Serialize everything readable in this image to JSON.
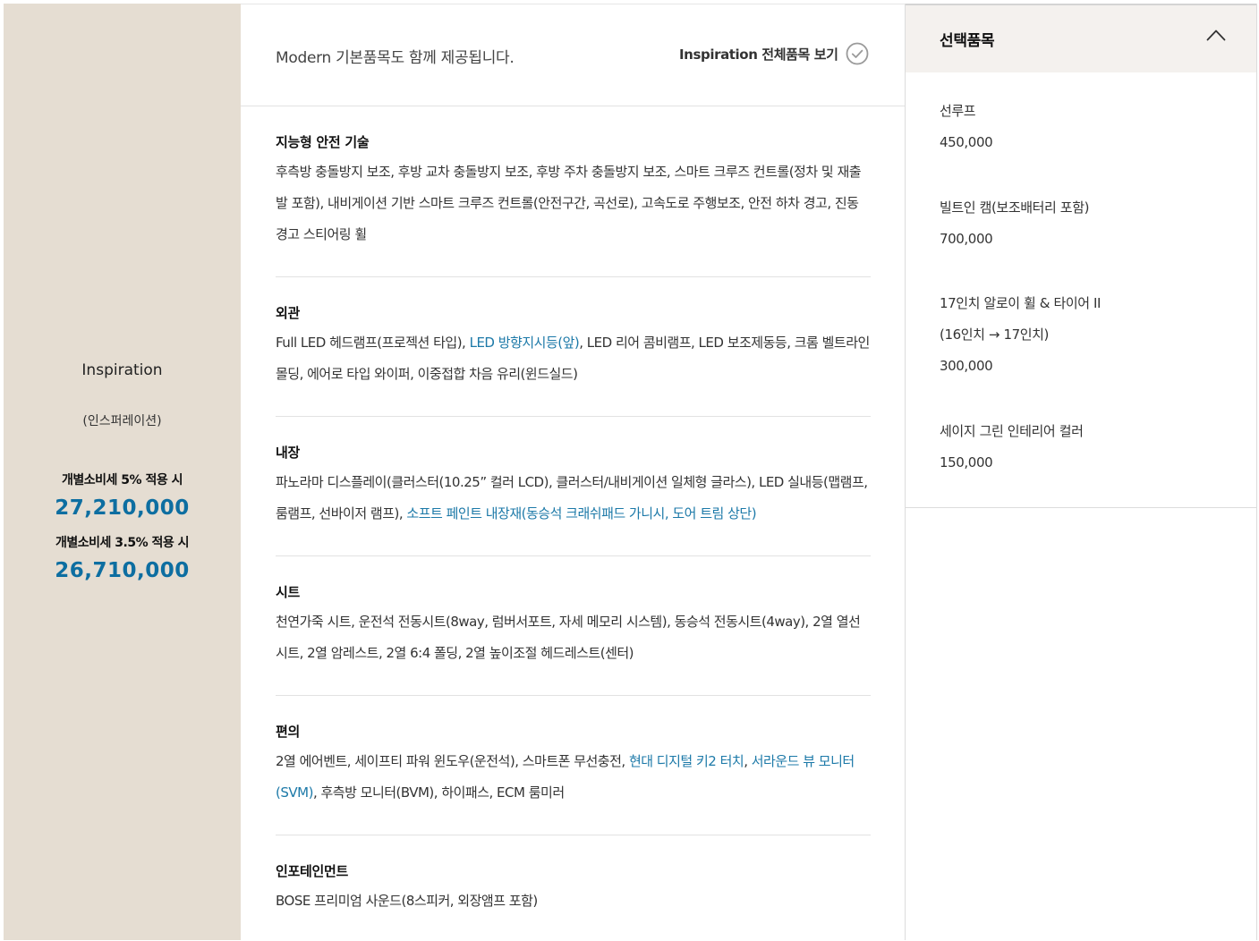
{
  "trim": {
    "name": "Inspiration",
    "sub": "(인스퍼레이션)",
    "tax5_label": "개별소비세 5% 적용 시",
    "tax5_price": "27,210,000",
    "tax35_label": "개별소비세 3.5% 적용 시",
    "tax35_price": "26,710,000"
  },
  "header": {
    "notice": "Modern 기본품목도 함께 제공됩니다.",
    "view_all": "Inspiration 전체품목 보기",
    "check_icon": "check-circle-icon"
  },
  "sections": [
    {
      "title": "지능형 안전 기술",
      "parts": [
        "후측방 충돌방지 보조, 후방 교차 충돌방지 보조, 후방 주차 충돌방지 보조, 스마트 크루즈 컨트롤(정차 및 재출발 포함), 내비게이션 기반 스마트 크루즈 컨트롤(안전구간, 곡선로), 고속도로 주행보조, 안전 하차 경고, 진동 경고 스티어링 휠"
      ]
    },
    {
      "title": "외관",
      "parts": [
        "Full LED 헤드램프(프로젝션 타입), ",
        "LED 방향지시등(앞)",
        ", LED 리어 콤비램프, LED 보조제동등, 크롬 벨트라인 몰딩, 에어로 타입 와이퍼, 이중접합 차음 유리(윈드실드)"
      ]
    },
    {
      "title": "내장",
      "parts": [
        "파노라마 디스플레이(클러스터(10.25” 컬러 LCD), 클러스터/내비게이션 일체형 글라스), LED 실내등(맵램프, 룸램프, 선바이저 램프), ",
        "소프트 페인트 내장재(동승석 크래쉬패드 가니시, 도어 트림 상단)"
      ]
    },
    {
      "title": "시트",
      "parts": [
        "천연가죽 시트, 운전석 전동시트(8way, 럼버서포트, 자세 메모리 시스템), 동승석 전동시트(4way), 2열 열선시트, 2열 암레스트, 2열 6:4 폴딩, 2열 높이조절 헤드레스트(센터)"
      ]
    },
    {
      "title": "편의",
      "parts": [
        "2열 에어벤트, 세이프티 파워 윈도우(운전석), 스마트폰 무선충전, ",
        "현대 디지털 키2 터치",
        ", ",
        "서라운드 뷰 모니터(SVM)",
        ", 후측방 모니터(BVM), 하이패스, ECM 룸미러"
      ]
    },
    {
      "title": "인포테인먼트",
      "parts": [
        "BOSE 프리미엄 사운드(8스피커, 외장앰프 포함)"
      ]
    }
  ],
  "selected": {
    "title": "선택품목",
    "collapse_icon": "chevron-up-icon",
    "items": [
      {
        "name": "선루프",
        "price": "450,000"
      },
      {
        "name": "빌트인 캠(보조배터리 포함)",
        "price": "700,000"
      },
      {
        "name": "17인치 알로이 휠 & 타이어 II",
        "name2": "(16인치 → 17인치)",
        "price": "300,000"
      },
      {
        "name": "세이지 그린 인테리어 컬러",
        "price": "150,000"
      }
    ]
  },
  "colors": {
    "left_panel_bg": "#e5ddd2",
    "price_accent": "#0d6ea1",
    "highlight_text": "#1c79a8",
    "right_header_bg": "#f4f1ee"
  }
}
